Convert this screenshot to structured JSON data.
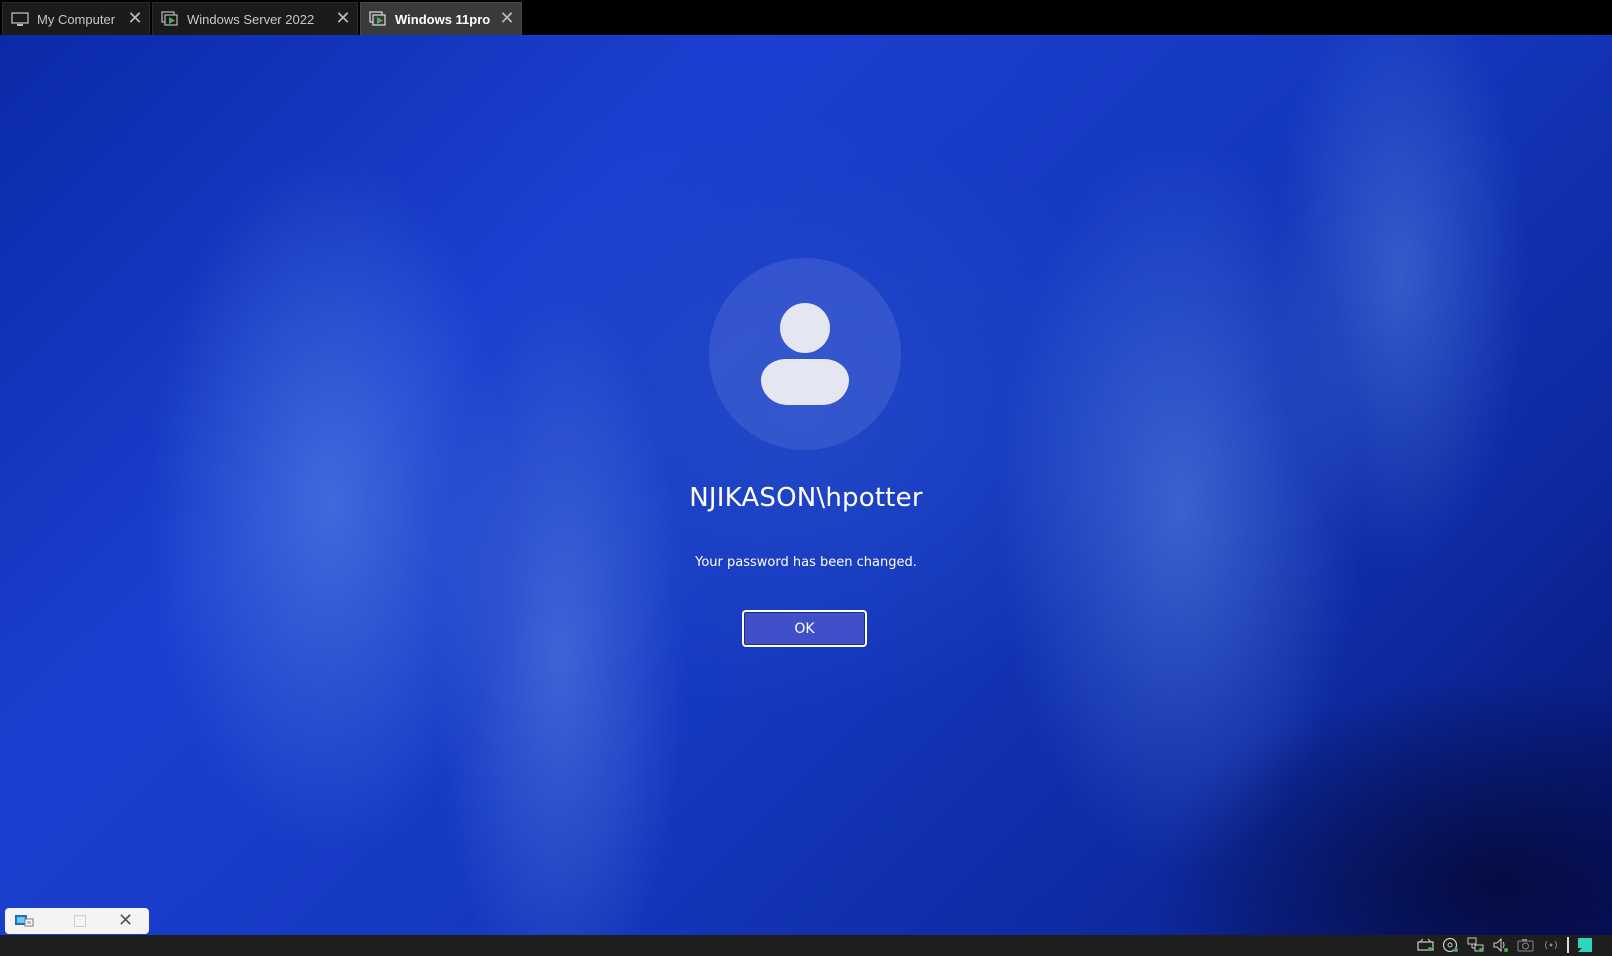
{
  "tabs": [
    {
      "label": "My Computer",
      "icon": "monitor-icon",
      "active": false
    },
    {
      "label": "Windows Server 2022",
      "icon": "vm-running-icon",
      "active": false
    },
    {
      "label": "Windows 11pro",
      "icon": "vm-running-icon",
      "active": true
    }
  ],
  "login": {
    "username": "NJIKASON\\hpotter",
    "message": "Your password has been changed.",
    "ok_label": "OK"
  },
  "status_icons": [
    "hard-disk-icon",
    "cd-dvd-icon",
    "network-icon",
    "sound-icon",
    "camera-icon",
    "wireless-icon",
    "message-icon"
  ],
  "colors": {
    "accent_green": "#4caf50",
    "button_fill": "#4050c8",
    "wallpaper_blue": "#1538c0"
  }
}
